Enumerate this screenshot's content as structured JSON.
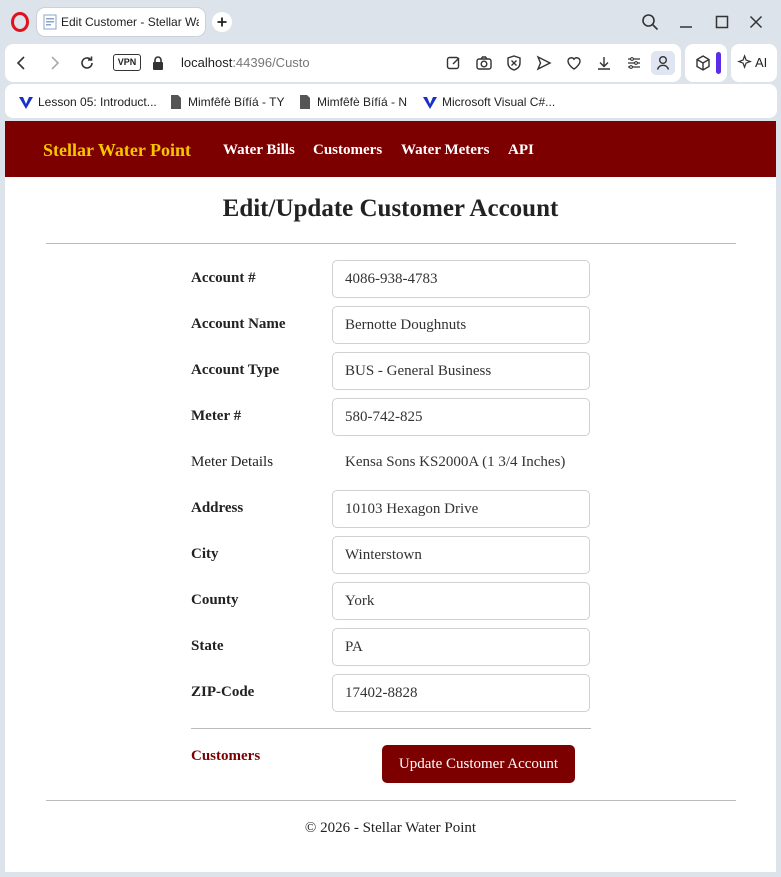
{
  "browser": {
    "tab_title": "Edit Customer - Stellar Water Point",
    "url_host": "localhost",
    "url_path": ":44396/Custo",
    "vpn_label": "VPN",
    "ai_label": "AI",
    "bookmarks": [
      {
        "label": "Lesson 05: Introduct...",
        "icon": "vs-icon"
      },
      {
        "label": "Mimfêfè Bífíá - TY",
        "icon": "document-icon"
      },
      {
        "label": "Mimfêfè Bífíá - N",
        "icon": "document-icon"
      },
      {
        "label": "Microsoft Visual C#...",
        "icon": "vs-icon"
      }
    ],
    "accent_color": "#5b2ee6"
  },
  "site": {
    "brand": "Stellar Water Point",
    "nav": [
      "Water Bills",
      "Customers",
      "Water Meters",
      "API"
    ],
    "brand_color": "#f7c600",
    "nav_bg": "#7d0000"
  },
  "page": {
    "title": "Edit/Update Customer Account",
    "fields": [
      {
        "label": "Account #",
        "value": "4086-938-4783"
      },
      {
        "label": "Account Name",
        "value": "Bernotte Doughnuts"
      },
      {
        "label": "Account Type",
        "value": "BUS - General Business"
      },
      {
        "label": "Meter #",
        "value": "580-742-825"
      },
      {
        "label": "Meter Details",
        "value": "Kensa Sons KS2000A (1 3/4 Inches)"
      },
      {
        "label": "Address",
        "value": "10103 Hexagon Drive"
      },
      {
        "label": "City",
        "value": "Winterstown"
      },
      {
        "label": "County",
        "value": "York"
      },
      {
        "label": "State",
        "value": "PA"
      },
      {
        "label": "ZIP-Code",
        "value": "17402-8828"
      }
    ],
    "back_link": "Customers",
    "submit_label": "Update Customer Account"
  },
  "footer": "© 2026 - Stellar Water Point"
}
